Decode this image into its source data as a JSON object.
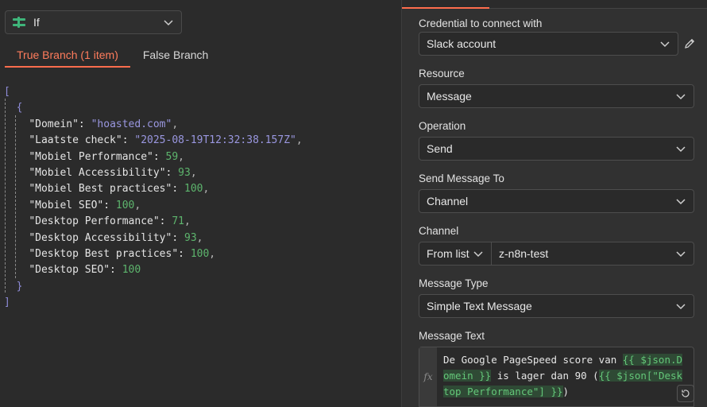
{
  "node": {
    "name": "If",
    "icon": "if-branch-icon"
  },
  "tabs": [
    {
      "label": "True Branch (1 item)",
      "active": true
    },
    {
      "label": "False Branch",
      "active": false
    }
  ],
  "json_output": [
    {
      "key": "Domein",
      "value": "\"hoasted.com\"",
      "type": "string"
    },
    {
      "key": "Laatste check",
      "value": "\"2025-08-19T12:32:38.157Z\"",
      "type": "string"
    },
    {
      "key": "Mobiel Performance",
      "value": "59",
      "type": "number"
    },
    {
      "key": "Mobiel Accessibility",
      "value": "93",
      "type": "number"
    },
    {
      "key": "Mobiel Best practices",
      "value": "100",
      "type": "number"
    },
    {
      "key": "Mobiel SEO",
      "value": "100",
      "type": "number"
    },
    {
      "key": "Desktop Performance",
      "value": "71",
      "type": "number"
    },
    {
      "key": "Desktop Accessibility",
      "value": "93",
      "type": "number"
    },
    {
      "key": "Desktop Best practices",
      "value": "100",
      "type": "number"
    },
    {
      "key": "Desktop SEO",
      "value": "100",
      "type": "number"
    }
  ],
  "form": {
    "credential": {
      "label": "Credential to connect with",
      "value": "Slack account"
    },
    "resource": {
      "label": "Resource",
      "value": "Message"
    },
    "operation": {
      "label": "Operation",
      "value": "Send"
    },
    "send_to": {
      "label": "Send Message To",
      "value": "Channel"
    },
    "channel": {
      "label": "Channel",
      "mode": "From list",
      "value": "z-n8n-test"
    },
    "message_type": {
      "label": "Message Type",
      "value": "Simple Text Message"
    },
    "message_text": {
      "label": "Message Text",
      "fx": "fx",
      "part1": "De Google PageSpeed score van  ",
      "expr1": "{{ $json.Domein }}",
      "part2": " is lager dan 90 (",
      "expr2": "{{ $json[\"Desktop Performance\"] }}",
      "part3": ")"
    }
  },
  "colors": {
    "accent": "#ff6d4d",
    "number": "#5db56d",
    "string": "#9a97e0",
    "expression": "#64c779"
  }
}
